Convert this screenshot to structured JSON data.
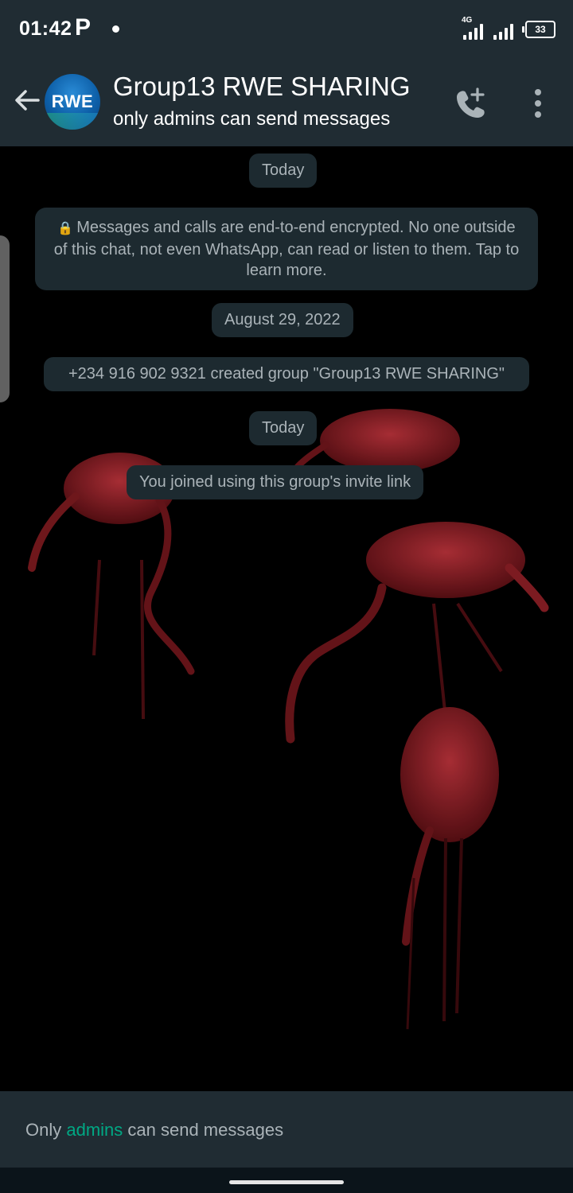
{
  "status_bar": {
    "time": "01:42",
    "p_icon": "P",
    "network_type": "4G",
    "battery": "33"
  },
  "header": {
    "avatar_text": "RWE",
    "title": "Group13 RWE SHARING",
    "subtitle": "only admins can send messages",
    "icons": [
      "arrow-left-icon",
      "add-call-icon",
      "more-vert-icon"
    ]
  },
  "messages": {
    "date_today_1": "Today",
    "encryption_notice": "Messages and calls are end-to-end encrypted. No one outside of this chat, not even WhatsApp, can read or listen to them. Tap to learn more.",
    "date_aug": "August 29, 2022",
    "created_group": "+234 916 902 9321 created group \"Group13 RWE SHARING\"",
    "date_today_2": "Today",
    "joined": "You joined using this group's invite link"
  },
  "footer": {
    "prefix": "Only ",
    "link": "admins",
    "suffix": " can send messages",
    "accent_color": "#00a884"
  },
  "colors": {
    "header_bg": "#202c33",
    "bubble_bg": "#1d2a30",
    "muted_text": "#aab3b8"
  }
}
